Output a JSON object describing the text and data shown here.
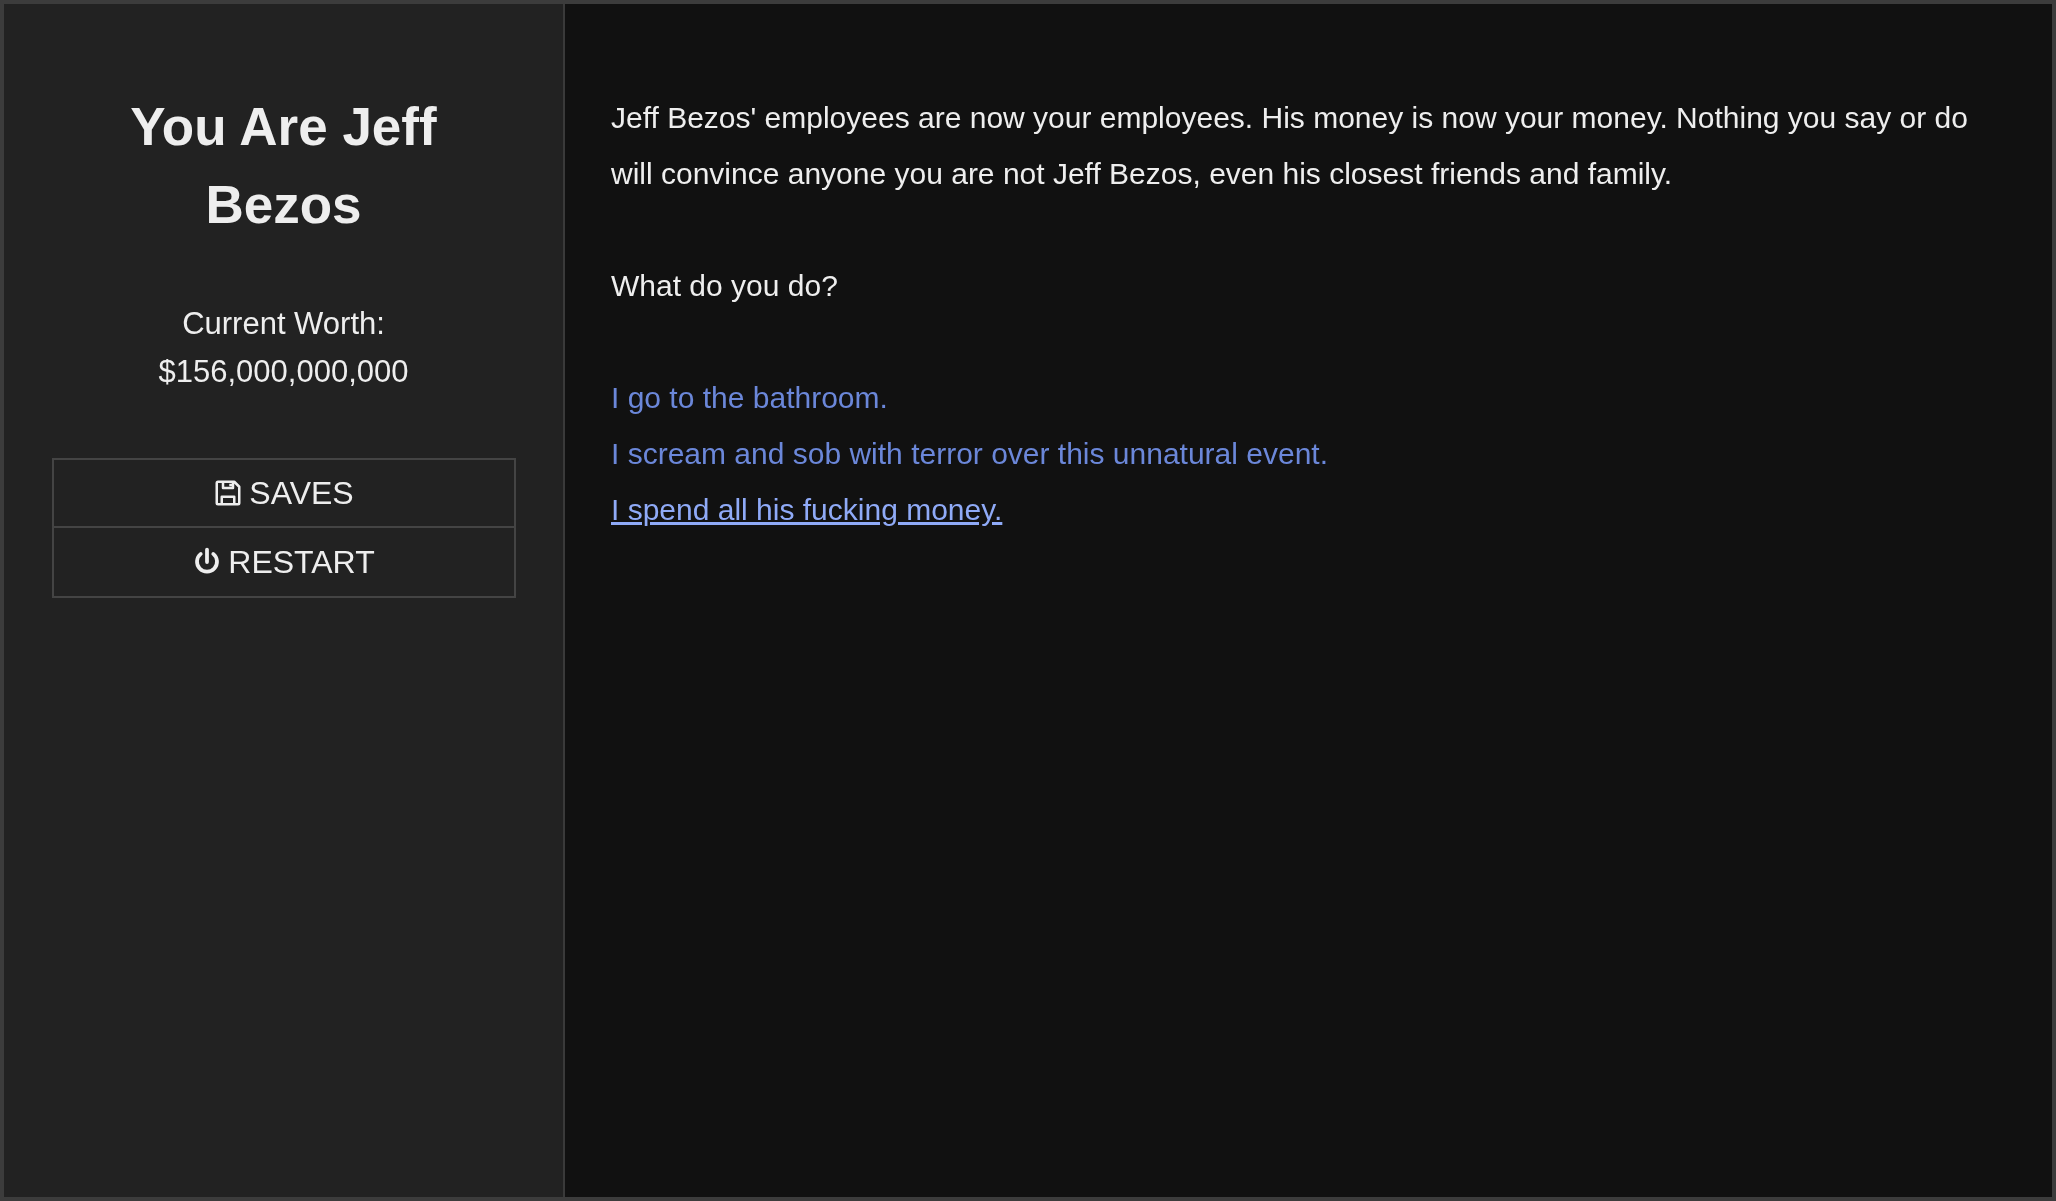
{
  "sidebar": {
    "title": "You Are Jeff Bezos",
    "worth_label": "Current Worth:",
    "worth_value": "$156,000,000,000",
    "menu": [
      {
        "kind": "saves",
        "label": "SAVES"
      },
      {
        "kind": "restart",
        "label": "RESTART"
      }
    ]
  },
  "passage": {
    "paragraphs": [
      "Jeff Bezos' employees are now your employees. His money is now your money. Nothing you say or do will convince anyone you are not Jeff Bezos, even his closest friends and family.",
      "What do you do?"
    ],
    "choices": [
      {
        "label": "I go to the bathroom.",
        "hovered": false
      },
      {
        "label": "I scream and sob with terror over this unnatural event.",
        "hovered": false
      },
      {
        "label": "I spend all his fucking money.",
        "hovered": true
      }
    ]
  }
}
